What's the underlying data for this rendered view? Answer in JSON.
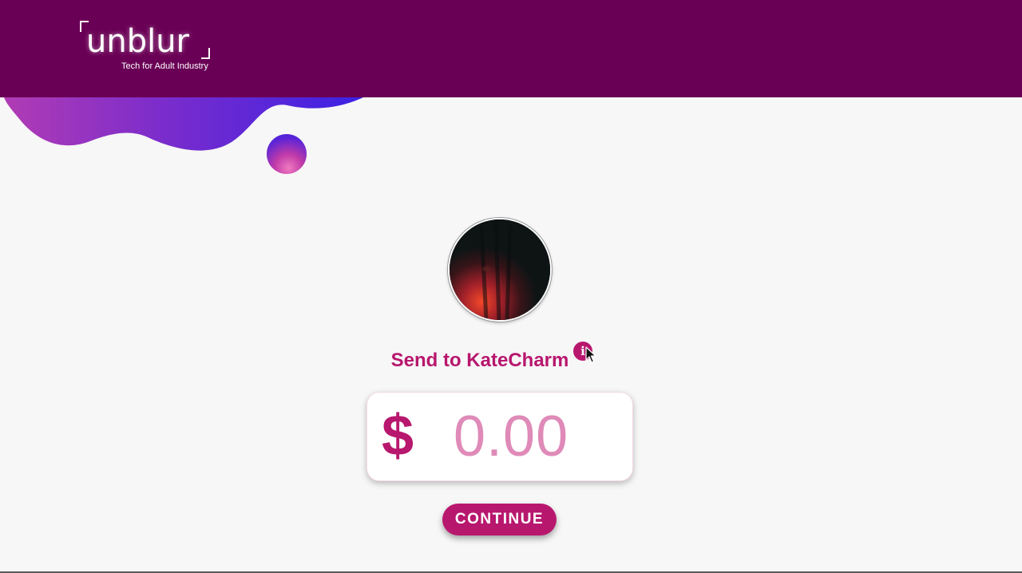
{
  "brand": {
    "name": "unblur",
    "tagline": "Tech for Adult Industry"
  },
  "recipient": {
    "send_label": "Send to KateCharm",
    "avatar_icon": "avatar-photo"
  },
  "info": {
    "icon_glyph": "i",
    "icon_name": "info-icon"
  },
  "amount": {
    "currency_symbol": "$",
    "placeholder": "0.00",
    "value": ""
  },
  "actions": {
    "continue_label": "CONTINUE"
  },
  "colors": {
    "header_bg": "#6a0055",
    "accent": "#b8176e",
    "amount_placeholder": "#df8ab8",
    "page_bg": "#f7f7f7"
  }
}
